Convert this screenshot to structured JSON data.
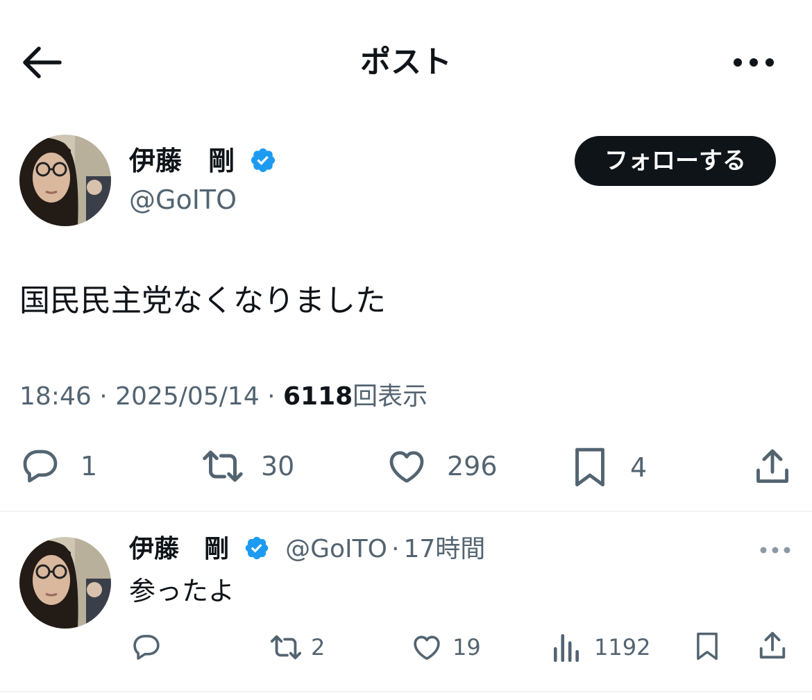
{
  "header": {
    "title": "ポスト",
    "back_icon": "arrow-left-icon",
    "more_icon": "more-horizontal-icon"
  },
  "post": {
    "author_name": "伊藤　剛",
    "handle": "@GoITO",
    "follow_label": "フォローする",
    "text": "国民民主党なくなりました",
    "time": "18:46",
    "date": "2025/05/14",
    "views": "6118",
    "views_suffix": "回表示",
    "separator": "·",
    "actions": {
      "replies": "1",
      "reposts": "30",
      "likes": "296",
      "bookmarks": "4"
    }
  },
  "reply": {
    "author_name": "伊藤　剛",
    "handle": "@GoITO",
    "age": "17時間",
    "text": "参ったよ",
    "actions": {
      "reposts": "2",
      "likes": "19",
      "views": "1192"
    }
  },
  "colors": {
    "text": "#0f1419",
    "secondary": "#536471",
    "verified": "#1d9bf0",
    "divider": "#eff3f4"
  }
}
